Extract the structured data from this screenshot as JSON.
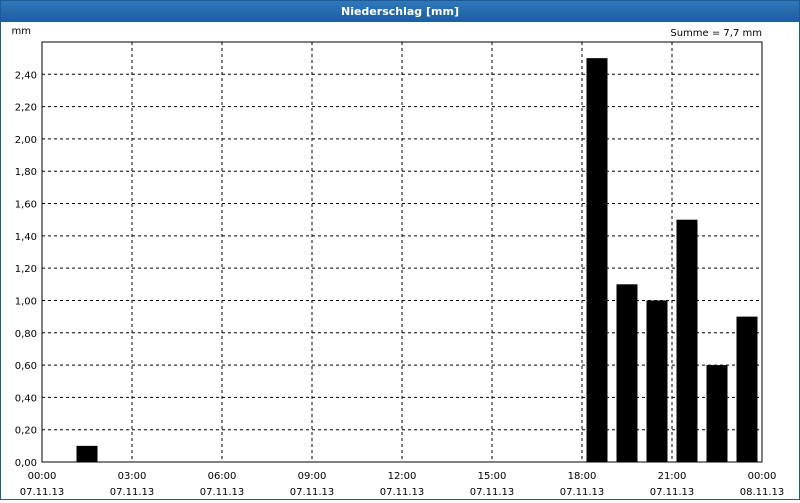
{
  "window": {
    "title": "Niederschlag [mm]"
  },
  "chart_data": {
    "type": "bar",
    "unit_label": "mm",
    "sum_label": "Summe = 7,7 mm",
    "ylim": [
      0,
      2.6
    ],
    "yticks": [
      {
        "value": 0.0,
        "label": "0,00"
      },
      {
        "value": 0.2,
        "label": "0,20"
      },
      {
        "value": 0.4,
        "label": "0,40"
      },
      {
        "value": 0.6,
        "label": "0,60"
      },
      {
        "value": 0.8,
        "label": "0,80"
      },
      {
        "value": 1.0,
        "label": "1,00"
      },
      {
        "value": 1.2,
        "label": "1,20"
      },
      {
        "value": 1.4,
        "label": "1,40"
      },
      {
        "value": 1.6,
        "label": "1,60"
      },
      {
        "value": 1.8,
        "label": "1,80"
      },
      {
        "value": 2.0,
        "label": "2,00"
      },
      {
        "value": 2.2,
        "label": "2,20"
      },
      {
        "value": 2.4,
        "label": "2,40"
      }
    ],
    "xlim_hours": [
      0,
      24
    ],
    "xticks": [
      {
        "hour": 0,
        "time": "00:00",
        "date": "07.11.13"
      },
      {
        "hour": 3,
        "time": "03:00",
        "date": "07.11.13"
      },
      {
        "hour": 6,
        "time": "06:00",
        "date": "07.11.13"
      },
      {
        "hour": 9,
        "time": "09:00",
        "date": "07.11.13"
      },
      {
        "hour": 12,
        "time": "12:00",
        "date": "07.11.13"
      },
      {
        "hour": 15,
        "time": "15:00",
        "date": "07.11.13"
      },
      {
        "hour": 18,
        "time": "18:00",
        "date": "07.11.13"
      },
      {
        "hour": 21,
        "time": "21:00",
        "date": "07.11.13"
      },
      {
        "hour": 24,
        "time": "00:00",
        "date": "08.11.13"
      }
    ],
    "bar_interval_hours": 1,
    "bars": [
      {
        "hour": 1,
        "value": 0.1
      },
      {
        "hour": 18,
        "value": 2.5
      },
      {
        "hour": 19,
        "value": 1.1
      },
      {
        "hour": 20,
        "value": 1.0
      },
      {
        "hour": 21,
        "value": 1.5
      },
      {
        "hour": 22,
        "value": 0.6
      },
      {
        "hour": 23,
        "value": 0.9
      }
    ],
    "grid": true,
    "colors": {
      "bar": "#000000",
      "grid": "#000000",
      "title_bar": "#1f5a93"
    }
  }
}
